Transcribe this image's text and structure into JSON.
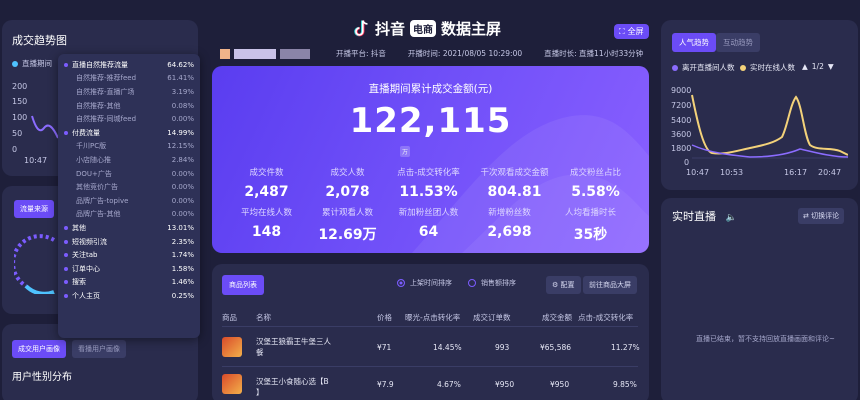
{
  "header": {
    "brand_text": "抖音",
    "brand_tag": "电商",
    "title": "数据主屏",
    "fullscreen_label": "全屏",
    "platform": "开播平台: 抖音",
    "start_time": "开播时间: 2021/08/05 10:29:00",
    "duration": "直播时长: 直播11小时33分钟"
  },
  "left": {
    "trend_title": "成交趋势图",
    "trend_legend": "直播期间",
    "trend_yticks": [
      "200",
      "150",
      "100",
      "50",
      "0"
    ],
    "trend_xtick": "10:47",
    "traffic_tab": "流量来源",
    "users_tabs": [
      "成交用户画像",
      "看播用户画像"
    ],
    "gender_title": "用户性别分布",
    "popup": [
      {
        "label": "直播自然推荐流量",
        "value": "64.62%",
        "level": "main"
      },
      {
        "label": "自然推荐-推荐feed",
        "value": "61.41%",
        "level": "sub"
      },
      {
        "label": "自然推荐-直播广场",
        "value": "3.19%",
        "level": "sub"
      },
      {
        "label": "自然推荐-其他",
        "value": "0.08%",
        "level": "sub"
      },
      {
        "label": "自然推荐-同城feed",
        "value": "0.00%",
        "level": "sub"
      },
      {
        "label": "付费流量",
        "value": "14.99%",
        "level": "main"
      },
      {
        "label": "千川PC版",
        "value": "12.15%",
        "level": "sub"
      },
      {
        "label": "小店随心推",
        "value": "2.84%",
        "level": "sub"
      },
      {
        "label": "DOU+广告",
        "value": "0.00%",
        "level": "sub"
      },
      {
        "label": "其他竞价广告",
        "value": "0.00%",
        "level": "sub"
      },
      {
        "label": "品牌广告-topive",
        "value": "0.00%",
        "level": "sub"
      },
      {
        "label": "品牌广告-其他",
        "value": "0.00%",
        "level": "sub"
      },
      {
        "label": "其他",
        "value": "13.01%",
        "level": "main"
      },
      {
        "label": "短视频引流",
        "value": "2.35%",
        "level": "main"
      },
      {
        "label": "关注tab",
        "value": "1.74%",
        "level": "main"
      },
      {
        "label": "订单中心",
        "value": "1.58%",
        "level": "main"
      },
      {
        "label": "搜索",
        "value": "1.46%",
        "level": "main"
      },
      {
        "label": "个人主页",
        "value": "0.25%",
        "level": "main"
      }
    ]
  },
  "hero": {
    "title": "直播期间累计成交金额(元)",
    "value": "122,115",
    "unit": "万",
    "stats": [
      {
        "label": "成交件数",
        "value": "2,487"
      },
      {
        "label": "成交人数",
        "value": "2,078"
      },
      {
        "label": "点击-成交转化率",
        "value": "11.53%"
      },
      {
        "label": "千次观看成交金额",
        "value": "804.81"
      },
      {
        "label": "成交粉丝占比",
        "value": "5.58%"
      },
      {
        "label": "平均在线人数",
        "value": "148"
      },
      {
        "label": "累计观看人数",
        "value": "12.69万"
      },
      {
        "label": "新加粉丝团人数",
        "value": "64"
      },
      {
        "label": "新增粉丝数",
        "value": "2,698"
      },
      {
        "label": "人均看播时长",
        "value": "35秒"
      }
    ]
  },
  "products": {
    "tab": "商品列表",
    "sort_options": [
      "上架时间排序",
      "销售额排序"
    ],
    "config_label": "配置",
    "goto_label": "前往商品大屏",
    "headers": [
      "商品",
      "名称",
      "价格",
      "曝光-点击转化率",
      "成交订单数",
      "成交金额",
      "点击-成交转化率"
    ],
    "rows": [
      {
        "name_line1": "汉堡王狼霸王牛堡三人",
        "name_line2": "餐",
        "price": "¥71",
        "ctr": "14.45%",
        "orders": "993",
        "amount": "¥65,586",
        "cvr": "11.27%"
      },
      {
        "name_line1": "汉堡王小食随心选【B",
        "name_line2": "】",
        "price": "¥7.9",
        "ctr": "4.67%",
        "orders": "¥950",
        "amount": "¥950",
        "cvr": "9.85%"
      }
    ]
  },
  "right": {
    "tabs": [
      "人气趋势",
      "互动趋势"
    ],
    "legend": [
      "离开直播间人数",
      "实时在线人数"
    ],
    "pager": "1/2",
    "yticks": [
      "9000",
      "7200",
      "5400",
      "3600",
      "1800",
      "0"
    ],
    "xticks": [
      "10:47",
      "10:53",
      "16:17",
      "20:47"
    ],
    "live_title": "实时直播",
    "switch_label": "切换评论",
    "live_empty": "直播已结束，暂不支持回放直播画面和评论~"
  },
  "colors": {
    "background": "#1e1f3a",
    "panel": "#2a2c4d",
    "accent": "#6b4cf6",
    "line_yellow": "#f3d27a",
    "line_purple": "#8b6cff"
  }
}
